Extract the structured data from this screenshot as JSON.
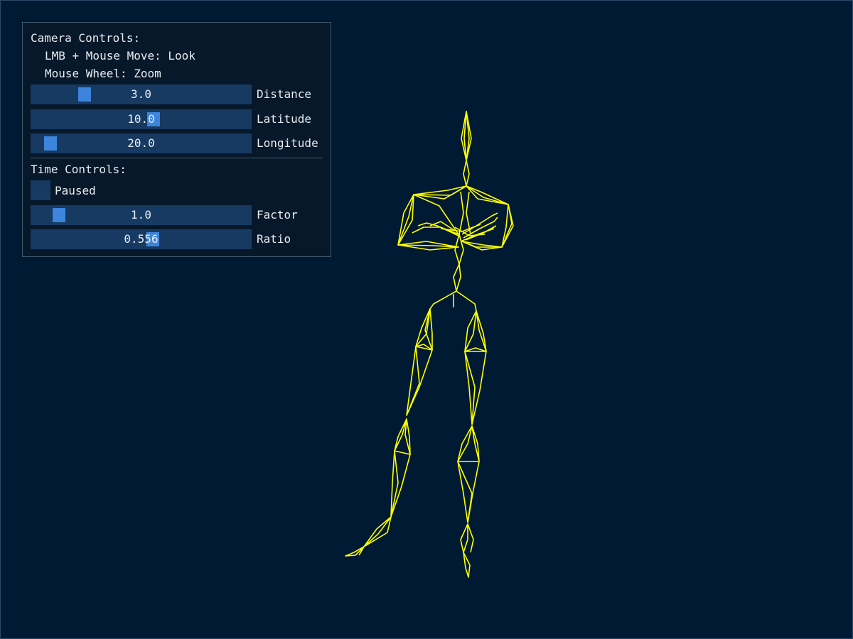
{
  "colors": {
    "background": "#001a33",
    "panel": "#07182a",
    "frame_bg": "#173a62",
    "slider_grab": "#3d84dc",
    "skeleton": "#ffff00"
  },
  "camera": {
    "header": "Camera Controls:",
    "hint_look": "LMB + Mouse Move: Look",
    "hint_zoom": "Mouse Wheel: Zoom",
    "distance": {
      "label": "Distance",
      "value": "3.0"
    },
    "latitude": {
      "label": "Latitude",
      "value": "10.0"
    },
    "longitude": {
      "label": "Longitude",
      "value": "20.0"
    }
  },
  "time": {
    "header": "Time Controls:",
    "paused": {
      "label": "Paused",
      "checked": false
    },
    "factor": {
      "label": "Factor",
      "value": "1.0"
    },
    "ratio": {
      "label": "Ratio",
      "value": "0.556"
    }
  },
  "scene": {
    "object": "skeleton-wireframe",
    "render_mode": "wireframe"
  }
}
